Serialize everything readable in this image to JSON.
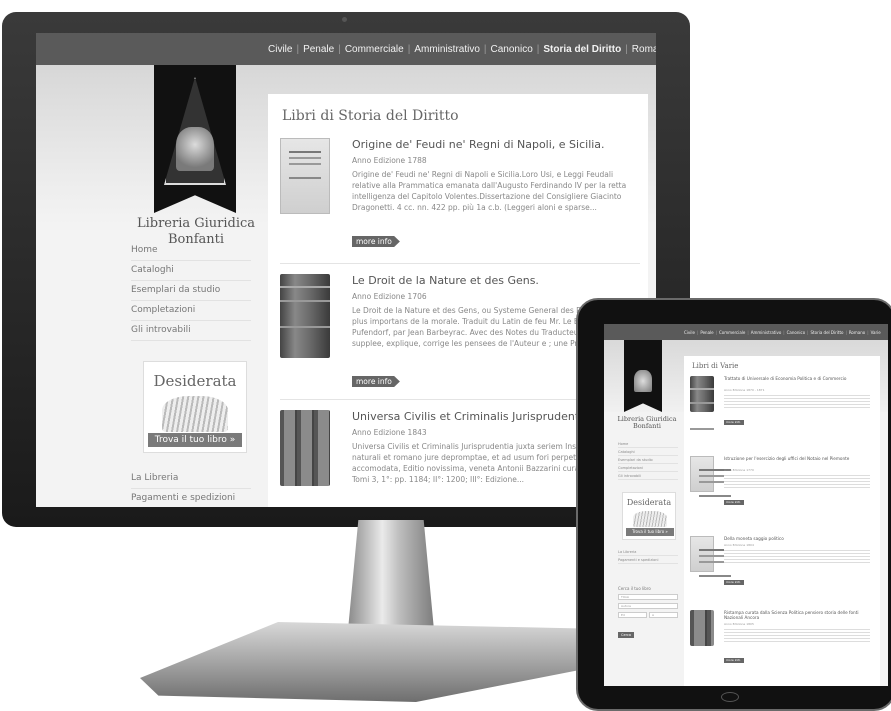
{
  "site": {
    "brand_line1": "Libreria Giuridica",
    "brand_line2": "Bonfanti",
    "nav": [
      "Civile",
      "Penale",
      "Commerciale",
      "Amministrativo",
      "Canonico",
      "Storia del Diritto",
      "Romano",
      "Varie"
    ],
    "nav_active_index": 5,
    "sidebar": [
      "Home",
      "Cataloghi",
      "Esemplari da studio",
      "Completazioni",
      "Gli introvabili"
    ],
    "desiderata": {
      "title": "Desiderata",
      "cta": "Trova il tuo libro »"
    },
    "sidebar2": [
      "La Libreria",
      "Pagamenti e spedizioni"
    ]
  },
  "desktop": {
    "heading": "Libri di Storia del Diritto",
    "records": [
      {
        "title": "Origine de' Feudi ne' Regni di Napoli, e Sicilia.",
        "year": "Anno Edizione 1788",
        "desc": "Origine de' Feudi ne' Regni di Napoli e Sicilia.Loro Usi, e Leggi Feudali relative alla Prammatica emanata dall'Augusto Ferdinando IV per la retta intelligenza del Capitolo Volentes.Dissertazione del Consigliere Giacinto Dragonetti. 4 cc. nn. 422 pp. più 1a c.b. (Leggeri aloni e sparse...",
        "more": "more info"
      },
      {
        "title": "Le Droit de la Nature et des Gens.",
        "year": "Anno Edizione 1706",
        "desc": "Le Droit de la Nature et des Gens, ou Systeme General des Principes les plus importans de la morale. Traduit du Latin de feu Mr. Le Baron de Pufendorf, par Jean Barbeyrac. Avec des Notes du Traducteur, ou il supplee, explique, corrige les pensees de l'Auteur e ; une Preface, qui...",
        "more": "more info"
      },
      {
        "title": "Universa Civilis et Criminalis Jurisprudentia",
        "year": "Anno Edizione 1843",
        "desc": "Universa Civilis et Criminalis Jurisprudentia juxta seriem Institutionum ex naturali et romano jure depromptae, et ad usum fori perpetuo accomodata, Editio novissima, veneta Antonii Bazzarini cura et impensis. Tomi 3, 1°: pp. 1184; II°: 1200; III°: Edizione...",
        "more": "more info"
      }
    ]
  },
  "tablet": {
    "heading": "Libri di Varie",
    "search": {
      "title": "Cerca il tuo libro",
      "fields": [
        "Titolo",
        "Autore",
        "Ed",
        "A"
      ],
      "button": "Cerca"
    },
    "records": [
      {
        "title": "Trattato di Universale di Economia Politica e di Commercio",
        "year": "Anno Edizione 1870 - 1871",
        "more": "more info"
      },
      {
        "title": "Istruzione per l'esercizio degli uffici del Notaio nel Piemonte",
        "year": "Anno Edizione 1770",
        "more": "more info"
      },
      {
        "title": "Della moneta saggio politico",
        "year": "Anno Edizione 1804",
        "more": "more info"
      },
      {
        "title": "Ristampa curata dalla Scienza Politica pensiero storia delle fonti Nazionali Ancora",
        "year": "Anno Edizione 1805",
        "more": "more info"
      }
    ]
  }
}
